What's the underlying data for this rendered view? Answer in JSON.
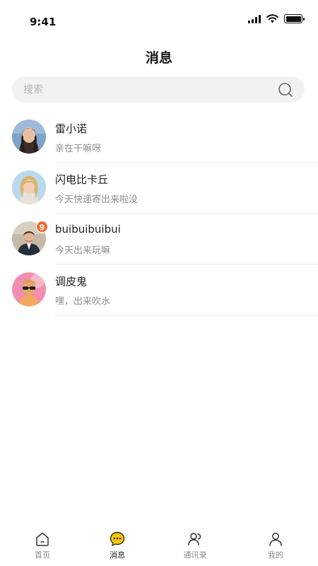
{
  "status_bar": {
    "time": "9:41"
  },
  "header": {
    "title": "消息"
  },
  "search": {
    "placeholder": "搜索"
  },
  "conversations": [
    {
      "name": "雷小诺",
      "preview": "亲在干嘛呀",
      "unread": ""
    },
    {
      "name": "闪电比卡丘",
      "preview": "今天快递寄出来啦没",
      "unread": ""
    },
    {
      "name": "buibuibuibui",
      "preview": "今天出来玩嘛",
      "unread": "9"
    },
    {
      "name": "调皮鬼",
      "preview": "嘿，出来吹水",
      "unread": ""
    }
  ],
  "tabbar": {
    "items": [
      {
        "label": "首页",
        "icon": "home-icon"
      },
      {
        "label": "消息",
        "icon": "message-icon",
        "active": true
      },
      {
        "label": "通讯录",
        "icon": "contacts-icon"
      },
      {
        "label": "我的",
        "icon": "profile-icon"
      }
    ]
  },
  "colors": {
    "accent": "#f5c518",
    "badge": "#ef6a2b"
  }
}
